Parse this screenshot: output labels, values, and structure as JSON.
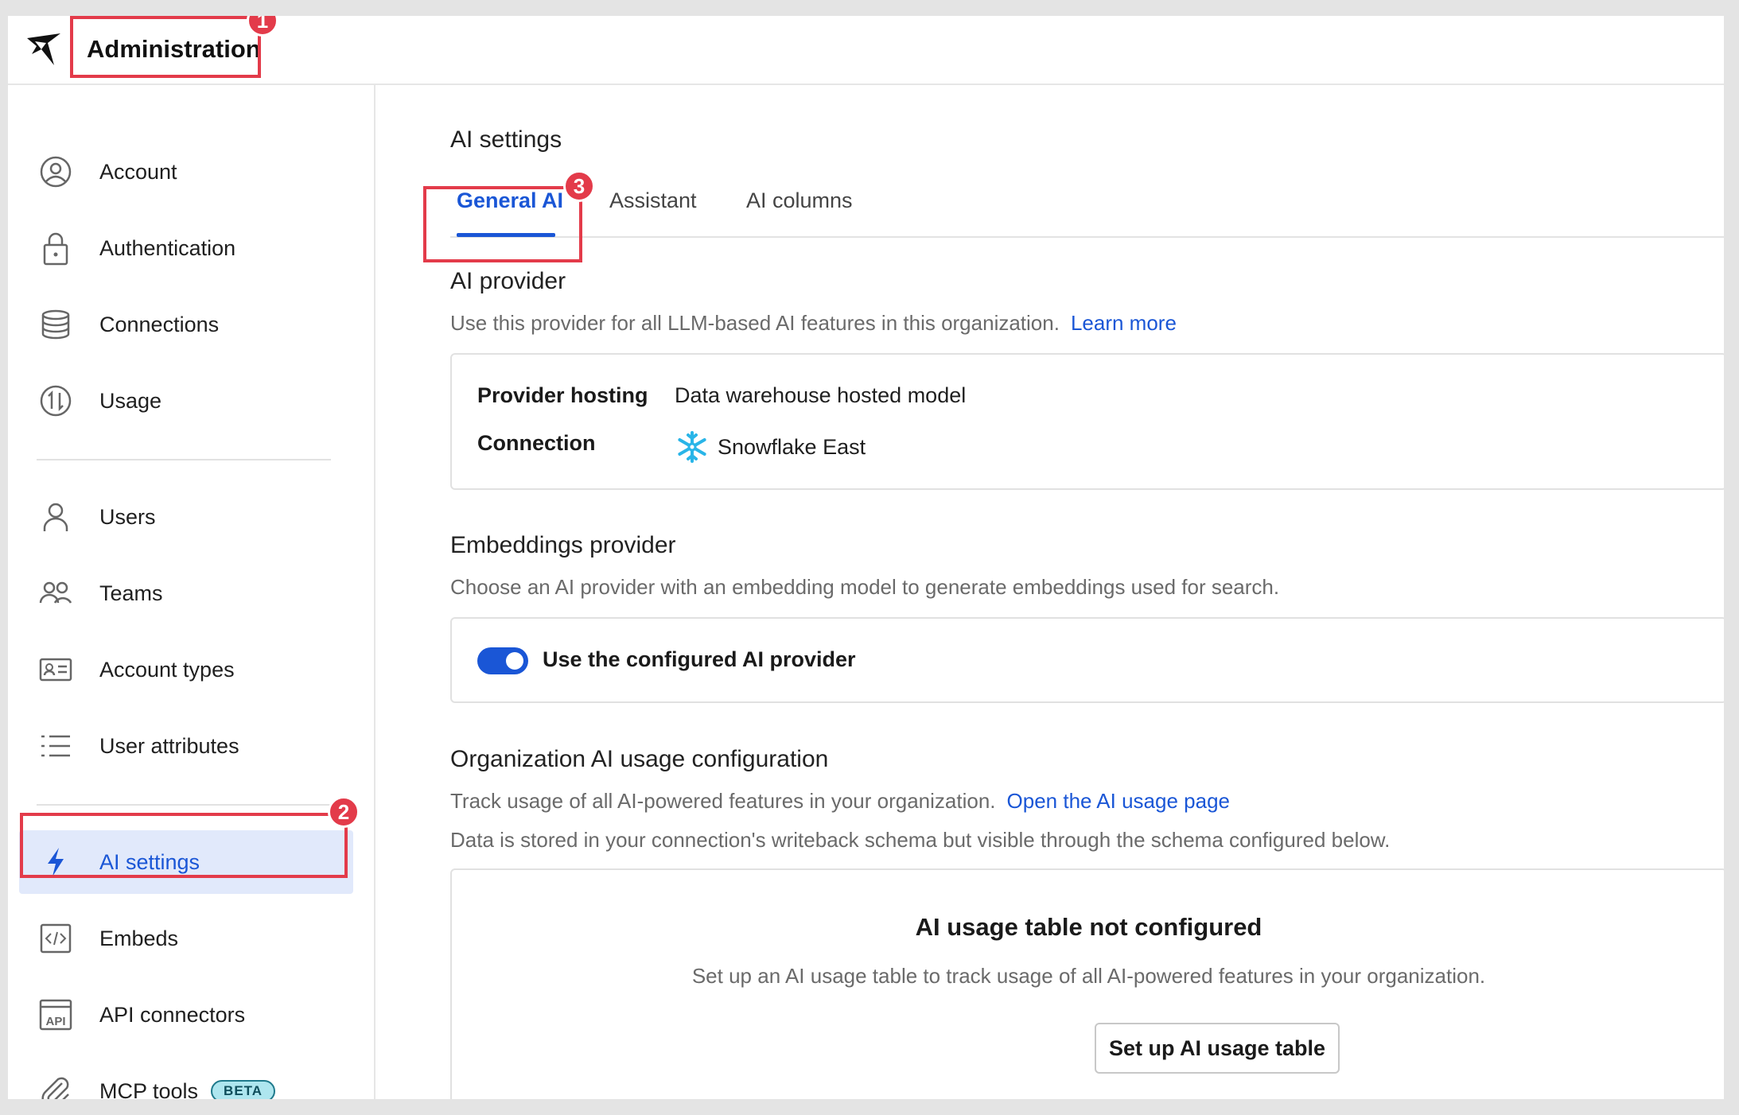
{
  "header": {
    "title": "Administration",
    "logo_icon": "bird-logo-icon"
  },
  "sidebar": {
    "items": [
      {
        "label": "Account",
        "icon": "account-circle-icon"
      },
      {
        "label": "Authentication",
        "icon": "lock-icon"
      },
      {
        "label": "Connections",
        "icon": "database-icon"
      },
      {
        "label": "Usage",
        "icon": "usage-icon"
      },
      {
        "label": "Users",
        "icon": "user-icon"
      },
      {
        "label": "Teams",
        "icon": "teams-icon"
      },
      {
        "label": "Account types",
        "icon": "id-card-icon"
      },
      {
        "label": "User attributes",
        "icon": "list-icon"
      },
      {
        "label": "AI settings",
        "icon": "lightning-icon",
        "active": true
      },
      {
        "label": "Embeds",
        "icon": "code-icon"
      },
      {
        "label": "API connectors",
        "icon": "api-icon"
      },
      {
        "label": "MCP tools",
        "icon": "paperclip-icon",
        "badge": "BETA"
      }
    ]
  },
  "main": {
    "title": "AI settings",
    "tabs": [
      {
        "label": "General AI",
        "active": true
      },
      {
        "label": "Assistant"
      },
      {
        "label": "AI columns"
      }
    ],
    "ai_provider": {
      "title": "AI provider",
      "description": "Use this provider for all LLM-based AI features in this organization.",
      "link": "Learn more",
      "hosting_label": "Provider hosting",
      "hosting_value": "Data warehouse hosted model",
      "connection_label": "Connection",
      "connection_value": "Snowflake East"
    },
    "embeddings": {
      "title": "Embeddings provider",
      "description": "Choose an AI provider with an embedding model to generate embeddings used for search.",
      "toggle_label": "Use the configured AI provider",
      "toggle_on": true
    },
    "usage_config": {
      "title": "Organization AI usage configuration",
      "description": "Track usage of all AI-powered features in your organization.",
      "link": "Open the AI usage page",
      "description2": "Data is stored in your connection's writeback schema but visible through the schema configured below.",
      "empty_title": "AI usage table not configured",
      "empty_description": "Set up an AI usage table to track usage of all AI-powered features in your organization.",
      "button": "Set up AI usage table"
    }
  },
  "callouts": [
    "1",
    "2",
    "3"
  ],
  "colors": {
    "accent": "#1a56d6",
    "callout": "#e33b4a",
    "active_bg": "#e1e9fb"
  }
}
